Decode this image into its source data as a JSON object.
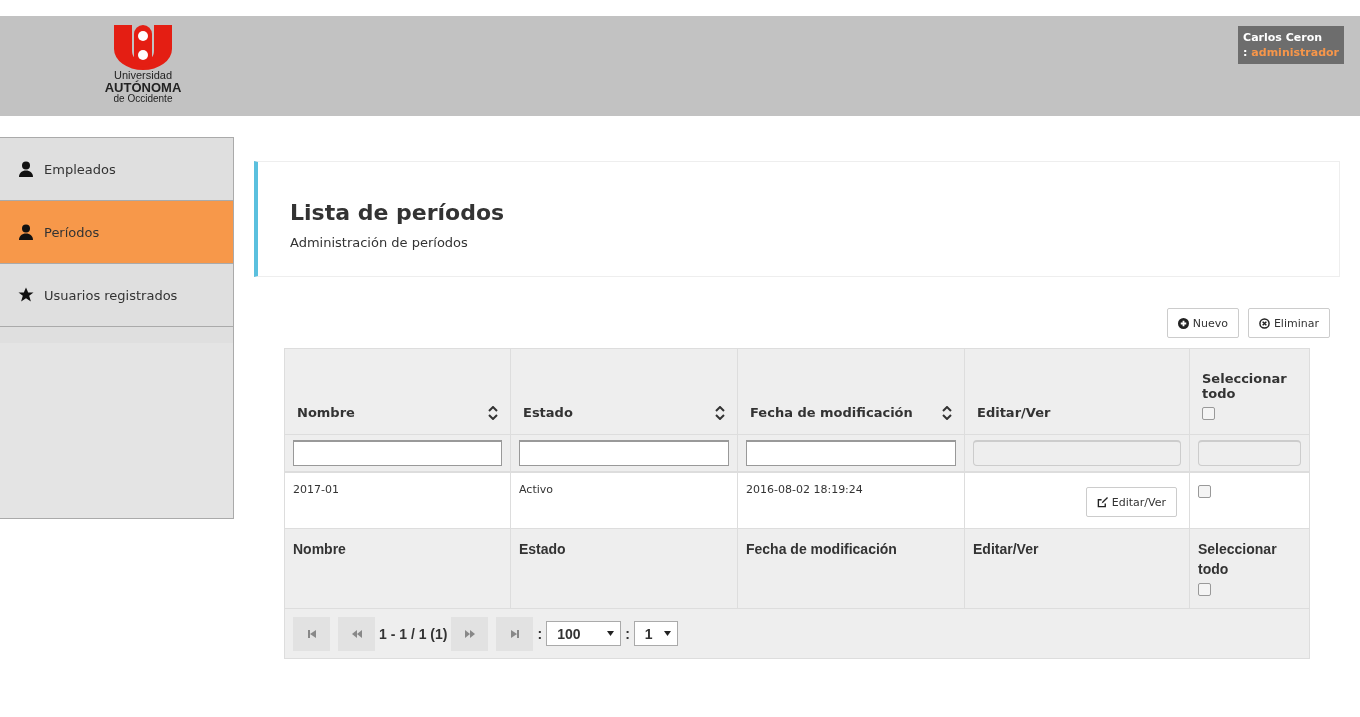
{
  "header": {
    "logo": {
      "line_1": "Universidad",
      "line_2": "AUTÓNOMA",
      "line_3": "de Occidente"
    },
    "user": {
      "name": "Carlos Ceron",
      "role_prefix": ":",
      "role": "administrador"
    }
  },
  "sidebar": {
    "items": [
      {
        "label": "Empleados",
        "kind": "user",
        "selected": false
      },
      {
        "label": "Períodos",
        "kind": "user",
        "selected": true
      },
      {
        "label": "Usuarios registrados",
        "kind": "star",
        "selected": false
      }
    ]
  },
  "panel": {
    "title": "Lista de períodos",
    "subtitle": "Administración de períodos"
  },
  "actions": [
    {
      "label": "Nuevo",
      "kind": "add"
    },
    {
      "label": "Eliminar",
      "kind": "delete"
    }
  ],
  "table": {
    "columns": [
      {
        "label": "Nombre",
        "kind": "sortable",
        "filter_disabled": false
      },
      {
        "label": "Estado",
        "kind": "sortable",
        "filter_disabled": false
      },
      {
        "label": "Fecha de modificación",
        "kind": "sortable",
        "filter_disabled": false
      },
      {
        "label": "Editar/Ver",
        "kind": "plain",
        "filter_disabled": true
      },
      {
        "label": "Seleccionar todo",
        "kind": "select",
        "filter_disabled": true,
        "checked": false
      }
    ],
    "rows": [
      {
        "nombre": "2017-01",
        "estado": "Activo",
        "fecha": "2016-08-02 18:19:24",
        "action": "Editar/Ver",
        "checked": false
      }
    ],
    "footer": [
      {
        "label": "Nombre",
        "kind": "plain"
      },
      {
        "label": "Estado",
        "kind": "plain"
      },
      {
        "label": "Fecha de modificación",
        "kind": "plain"
      },
      {
        "label": "Editar/Ver",
        "kind": "plain"
      },
      {
        "label": "Seleccionar todo",
        "kind": "select",
        "checked": false
      }
    ],
    "pager": {
      "range": "1 - 1 / 1 (1)",
      "separator_1": ":",
      "page_size": "100",
      "separator_2": ":",
      "page": "1"
    }
  }
}
